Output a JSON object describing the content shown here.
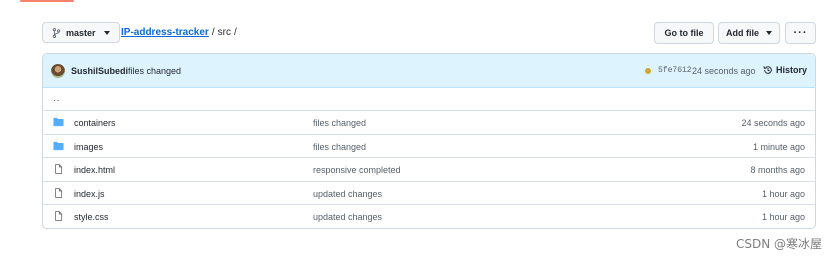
{
  "toolbar": {
    "branch_label": "master",
    "breadcrumb_repo": "IP-address-tracker",
    "breadcrumb_sep1": "/",
    "breadcrumb_dir": "src",
    "breadcrumb_sep2": "/",
    "goto_file_label": "Go to file",
    "add_file_label": "Add file",
    "more_label": "···"
  },
  "commit": {
    "author": "SushilSubedi",
    "message": "files changed",
    "sha": "5fe7612",
    "time": "24 seconds ago",
    "history_label": "History",
    "status_color": "#d4a72c"
  },
  "parent_link": "..",
  "files": [
    {
      "type": "folder",
      "name": "containers",
      "message": "files changed",
      "age": "24 seconds ago"
    },
    {
      "type": "folder",
      "name": "images",
      "message": "files changed",
      "age": "1 minute ago"
    },
    {
      "type": "file",
      "name": "index.html",
      "message": "responsive completed",
      "age": "8 months ago"
    },
    {
      "type": "file",
      "name": "index.js",
      "message": "updated changes",
      "age": "1 hour ago"
    },
    {
      "type": "file",
      "name": "style.css",
      "message": "updated changes",
      "age": "1 hour ago"
    }
  ],
  "icons": {
    "folder_color": "#54aeff",
    "file_color": "#57606a"
  },
  "watermark": "CSDN @寒冰屋"
}
